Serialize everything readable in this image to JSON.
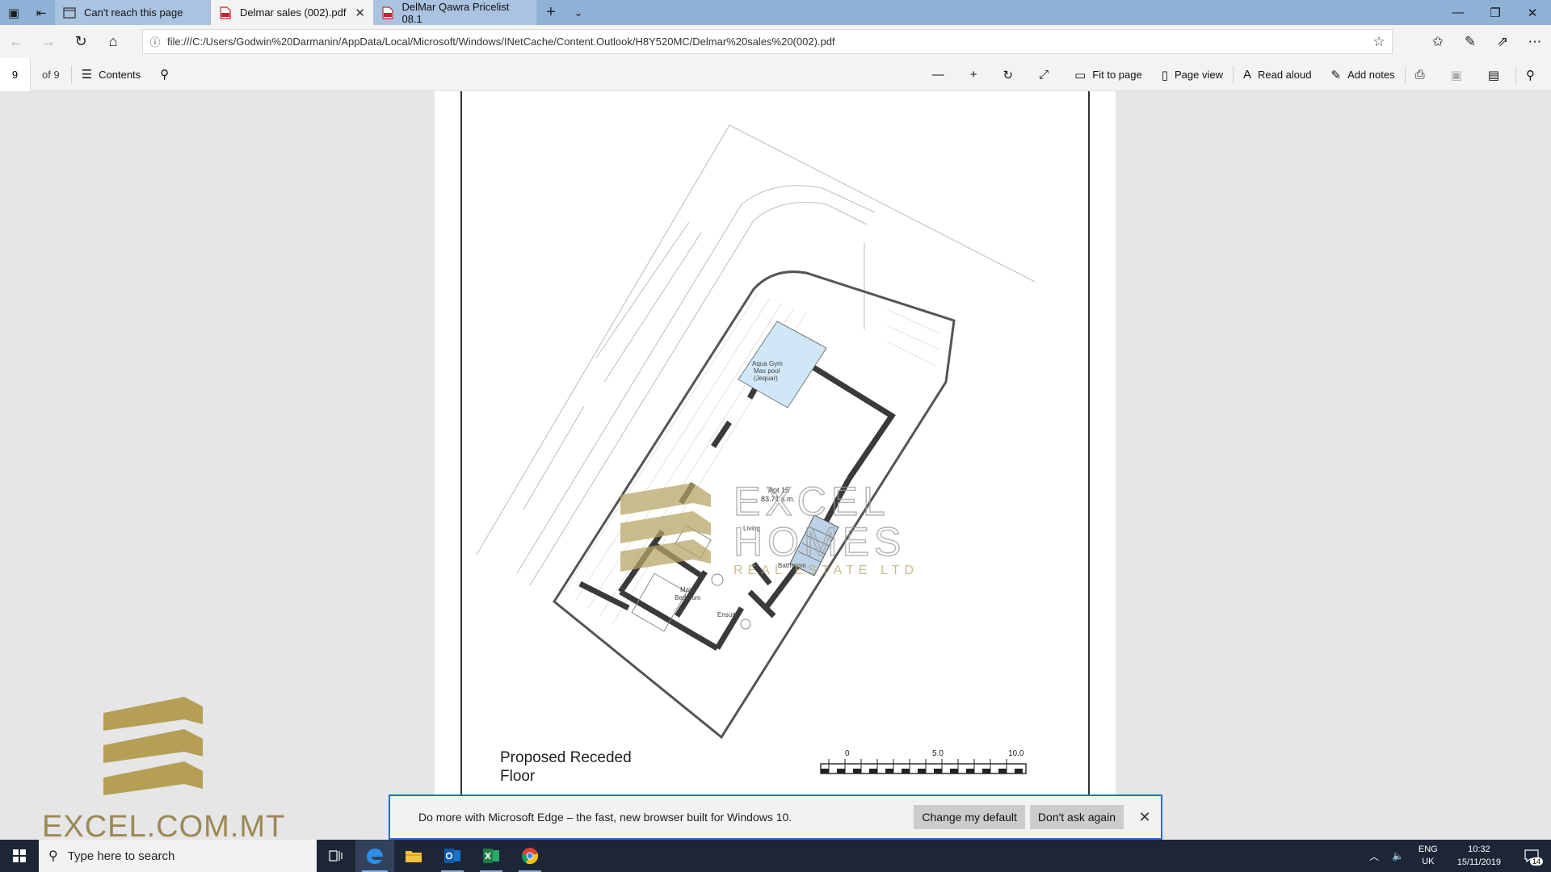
{
  "browser": {
    "tabs": [
      {
        "label": "Can't reach this page",
        "icon": "page-icon",
        "active": false
      },
      {
        "label": "Delmar sales (002).pdf",
        "icon": "pdf-icon",
        "active": true
      },
      {
        "label": "DelMar Qawra Pricelist 08.1",
        "icon": "pdf-icon",
        "active": false
      }
    ],
    "url": "file:///C:/Users/Godwin%20Darmanin/AppData/Local/Microsoft/Windows/INetCache/Content.Outlook/H8Y520MC/Delmar%20sales%20(002).pdf"
  },
  "pdf_toolbar": {
    "page_current": "9",
    "page_total": "of 9",
    "contents_label": "Contents",
    "fit_label": "Fit to page",
    "page_view_label": "Page view",
    "read_aloud_label": "Read aloud",
    "add_notes_label": "Add notes"
  },
  "plan": {
    "caption_line1": "Proposed Receded",
    "caption_line2": "Floor",
    "apartment_label": "Apt 15",
    "apartment_area": "83.71 s.m.",
    "rooms": [
      "Aqua Gym",
      "Max pool",
      "(Jequar)",
      "Living",
      "Bathroom",
      "Main",
      "Bedroom",
      "Ensuite"
    ],
    "scale_labels": [
      "0",
      "5.0",
      "10.0"
    ]
  },
  "watermark": {
    "center_line1": "EXCEL",
    "center_line2": "HOMES",
    "center_line3": "REAL ESTATE LTD",
    "site_text": "EXCEL.COM.MT"
  },
  "notification": {
    "message": "Do more with Microsoft Edge – the fast, new browser built for Windows 10.",
    "change_default_label": "Change my default",
    "dont_ask_label": "Don't ask again"
  },
  "taskbar": {
    "search_placeholder": "Type here to search",
    "lang_line1": "ENG",
    "lang_line2": "UK",
    "time": "10:32",
    "date": "15/11/2019",
    "notification_count": "14"
  }
}
